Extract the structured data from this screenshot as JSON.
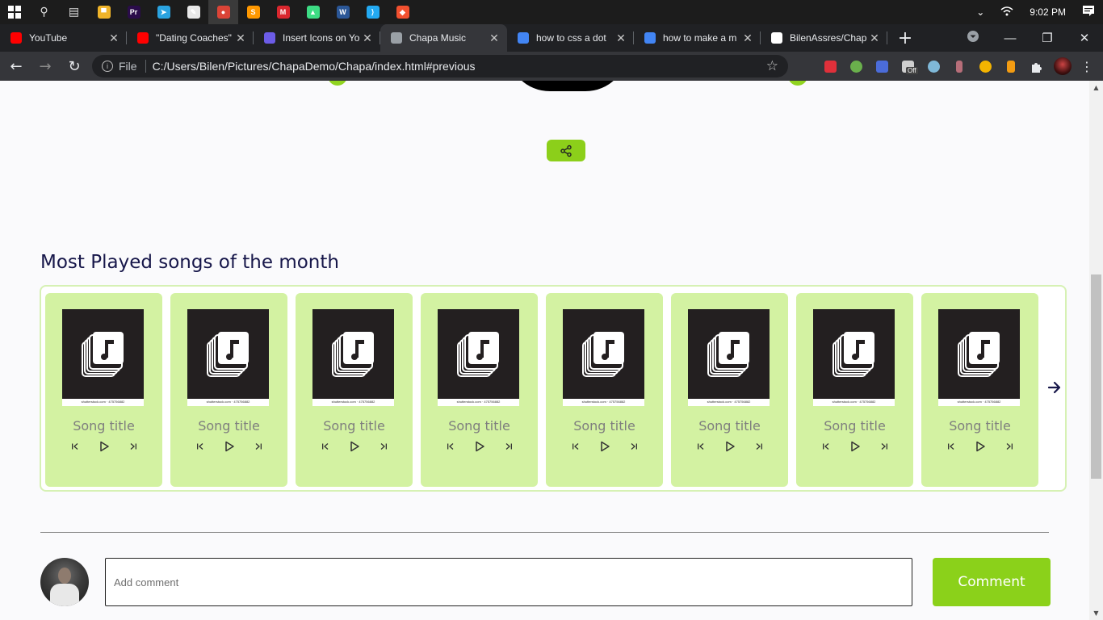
{
  "taskbar": {
    "apps": [
      {
        "name": "search",
        "glyph": "⚲"
      },
      {
        "name": "task-view",
        "glyph": "▤"
      },
      {
        "name": "file-explorer",
        "color": "#f0b429",
        "glyph": "▀"
      },
      {
        "name": "premiere",
        "color": "#2a0c4a",
        "glyph": "Pr"
      },
      {
        "name": "telegram",
        "color": "#2aa3e0",
        "glyph": "➤"
      },
      {
        "name": "paint",
        "color": "#e8e8e8",
        "glyph": "✎"
      },
      {
        "name": "chrome",
        "color": "#db4437",
        "glyph": "●"
      },
      {
        "name": "sublime",
        "color": "#ff9800",
        "glyph": "S"
      },
      {
        "name": "mega",
        "color": "#d9272e",
        "glyph": "M"
      },
      {
        "name": "android",
        "color": "#3ddc84",
        "glyph": "▲"
      },
      {
        "name": "word",
        "color": "#2b5797",
        "glyph": "W"
      },
      {
        "name": "vscode",
        "color": "#23a9f2",
        "glyph": "⟩"
      },
      {
        "name": "git",
        "color": "#f1502f",
        "glyph": "◆"
      }
    ],
    "time": "9:02 PM"
  },
  "tabs": [
    {
      "title": "YouTube",
      "favicon_color": "#ff0000",
      "active": false
    },
    {
      "title": "\"Dating Coaches\"",
      "favicon_color": "#ff0000",
      "active": false
    },
    {
      "title": "Insert Icons on Yo",
      "favicon_color": "#6c5ce7",
      "active": false
    },
    {
      "title": "Chapa Music",
      "favicon_color": "#9aa0a6",
      "active": true
    },
    {
      "title": "how to css a dot",
      "favicon_color": "#4285f4",
      "active": false
    },
    {
      "title": "how to make a m",
      "favicon_color": "#4285f4",
      "active": false
    },
    {
      "title": "BilenAssres/Chap",
      "favicon_color": "#ffffff",
      "active": false
    }
  ],
  "address_bar": {
    "scheme_label": "File",
    "url": "C:/Users/Bilen/Pictures/ChapaDemo/Chapa/index.html#previous"
  },
  "extensions": {
    "off_badge": "Off"
  },
  "page": {
    "section_title": "Most Played songs of the month",
    "songs": [
      {
        "title": "Song title",
        "credit": "shutterstock.com · 475756882"
      },
      {
        "title": "Song title",
        "credit": "shutterstock.com · 475756882"
      },
      {
        "title": "Song title",
        "credit": "shutterstock.com · 475756882"
      },
      {
        "title": "Song title",
        "credit": "shutterstock.com · 475756882"
      },
      {
        "title": "Song title",
        "credit": "shutterstock.com · 475756882"
      },
      {
        "title": "Song title",
        "credit": "shutterstock.com · 475756882"
      },
      {
        "title": "Song title",
        "credit": "shutterstock.com · 475756882"
      },
      {
        "title": "Song title",
        "credit": "shutterstock.com · 475756882"
      }
    ],
    "comment": {
      "placeholder": "Add comment",
      "button_label": "Comment"
    }
  },
  "colors": {
    "accent": "#8ccf1a",
    "card_bg": "#d3f2a2",
    "title": "#17174a"
  }
}
